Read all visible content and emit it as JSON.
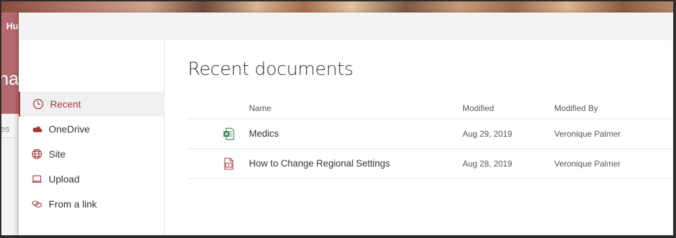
{
  "background": {
    "header_text": "Hu",
    "title_fragment": "na",
    "side_fragment": "es"
  },
  "nav": {
    "items": [
      {
        "label": "Recent",
        "icon": "clock-icon",
        "active": true
      },
      {
        "label": "OneDrive",
        "icon": "onedrive-cloud-icon",
        "active": false
      },
      {
        "label": "Site",
        "icon": "globe-icon",
        "active": false
      },
      {
        "label": "Upload",
        "icon": "laptop-upload-icon",
        "active": false
      },
      {
        "label": "From a link",
        "icon": "link-icon",
        "active": false
      }
    ]
  },
  "main": {
    "title": "Recent documents",
    "columns": [
      "Name",
      "Modified",
      "Modified By"
    ],
    "rows": [
      {
        "icon": "excel-file-icon",
        "name": "Medics",
        "modified": "Aug 29, 2019",
        "modified_by": "Veronique Palmer"
      },
      {
        "icon": "video-file-icon",
        "name": "How to Change Regional Settings",
        "modified": "Aug 28, 2019",
        "modified_by": "Veronique Palmer"
      }
    ]
  },
  "colors": {
    "accent": "#a4373a",
    "excel_green": "#1e7145",
    "onedrive_red": "#a4373a"
  }
}
